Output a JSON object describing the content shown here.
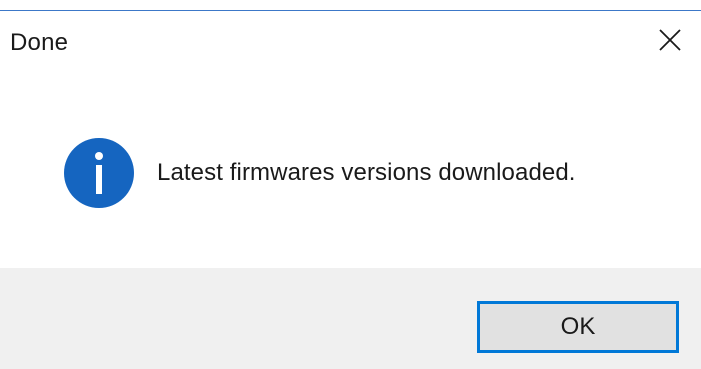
{
  "dialog": {
    "title": "Done",
    "message": "Latest firmwares versions downloaded.",
    "icon": "info-icon",
    "ok_label": "OK",
    "close_icon": "close-icon"
  },
  "colors": {
    "accent": "#0078d7",
    "info_icon": "#1565c0",
    "footer_bg": "#f0f0f0",
    "button_bg": "#e1e1e1"
  }
}
